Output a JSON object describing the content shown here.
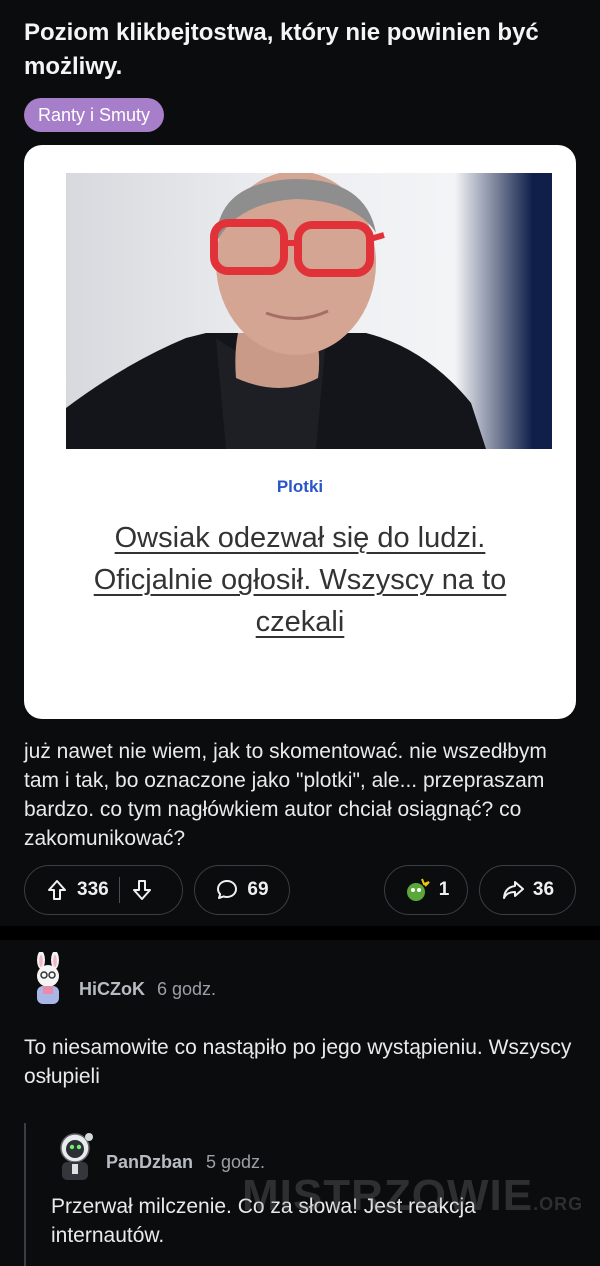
{
  "post": {
    "title": "Poziom klikbejtostwa, który nie powinien być możliwy.",
    "flair": "Ranty i Smuty",
    "flair_color": "#a77ec9",
    "image": {
      "category": "Plotki",
      "headline": "Owsiak odezwał się do ludzi. Oficjalnie ogłosił. Wszyscy na to czekali"
    },
    "body": "już nawet nie wiem, jak to skomentować. nie wszedłbym tam i tak, bo oznaczone jako \"plotki\", ale... przepraszam bardzo. co tym nagłówkiem autor chciał osiągnąć? co zakomunikować?",
    "actions": {
      "upvotes": "336",
      "comments": "69",
      "awards": "1",
      "shares": "36"
    }
  },
  "comments": [
    {
      "username": "HiCZoK",
      "time": "6 godz.",
      "text": "To niesamowite co nastąpiło po jego wystąpieniu. Wszyscy osłupieli",
      "avatar_icon": "bunny-ears-avatar-icon"
    },
    {
      "username": "PanDzban",
      "time": "5 godz.",
      "text": "Przerwał milczenie. Co za słowa! Jest reakcja internautów.",
      "avatar_icon": "astronaut-avatar-icon"
    }
  ],
  "watermark": {
    "main": "MISTRZOWIE",
    "suffix": ".ORG"
  }
}
